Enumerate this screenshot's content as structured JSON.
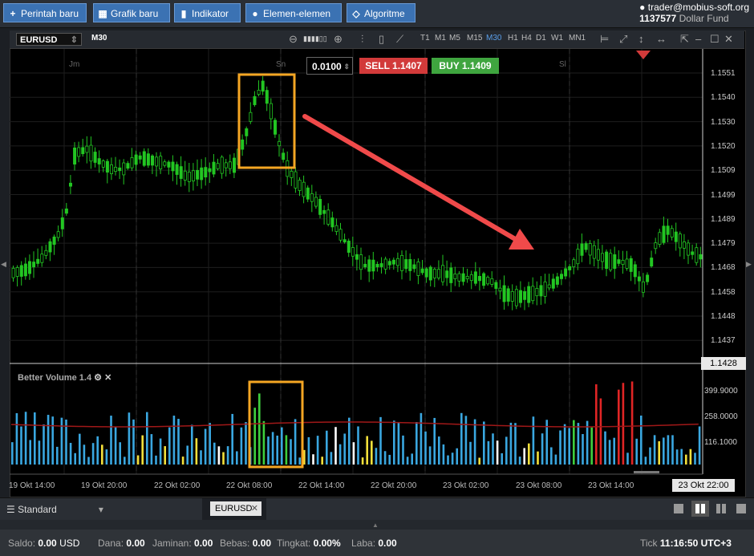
{
  "toolbar": {
    "new_order": "Perintah baru",
    "new_chart": "Grafik baru",
    "indicator": "Indikator",
    "elements": "Elemen-elemen",
    "algorithm": "Algoritme"
  },
  "account": {
    "user": "trader@mobius-soft.org",
    "number": "1137577",
    "fund": "Dollar Fund"
  },
  "chart": {
    "symbol": "EURUSD",
    "timeframe": "M30",
    "timeframes": [
      "T1",
      "M1",
      "M5",
      "M15",
      "M30",
      "H1",
      "H4",
      "D1",
      "W1",
      "MN1"
    ],
    "active_timeframe": "M30",
    "lot": "0.0100",
    "sell": "SELL 1.1407",
    "buy": "BUY 1.1409",
    "day_labels": [
      "Jm",
      "Sn",
      "Sl"
    ],
    "price_axis": [
      "1.1551",
      "1.1540",
      "1.1530",
      "1.1520",
      "1.1509",
      "1.1499",
      "1.1489",
      "1.1479",
      "1.1468",
      "1.1458",
      "1.1448",
      "1.1437"
    ],
    "current_price": "1.1428",
    "date_axis": [
      "19 Okt 14:00",
      "19 Okt 20:00",
      "22 Okt 02:00",
      "22 Okt 08:00",
      "22 Okt 14:00",
      "22 Okt 20:00",
      "23 Okt 02:00",
      "23 Okt 08:00",
      "23 Okt 14:00"
    ],
    "current_date": "23 Okt 22:00",
    "colors": {
      "up": "#22c622",
      "down": "#22c622",
      "arrow": "#f04a4a",
      "box": "#f5a623"
    }
  },
  "volume": {
    "title": "Better Volume 1.4",
    "axis": [
      "399.9000",
      "258.0000",
      "116.1000"
    ]
  },
  "layout": {
    "profile": "Standard",
    "tab": "EURUSD"
  },
  "status": {
    "saldo_label": "Saldo:",
    "saldo": "0.00",
    "currency": "USD",
    "dana_label": "Dana:",
    "dana": "0.00",
    "jaminan_label": "Jaminan:",
    "jaminan": "0.00",
    "bebas_label": "Bebas:",
    "bebas": "0.00",
    "tingkat_label": "Tingkat:",
    "tingkat": "0.00%",
    "laba_label": "Laba:",
    "laba": "0.00",
    "tick_label": "Tick",
    "time": "11:16:50",
    "utc": "UTC+3"
  }
}
